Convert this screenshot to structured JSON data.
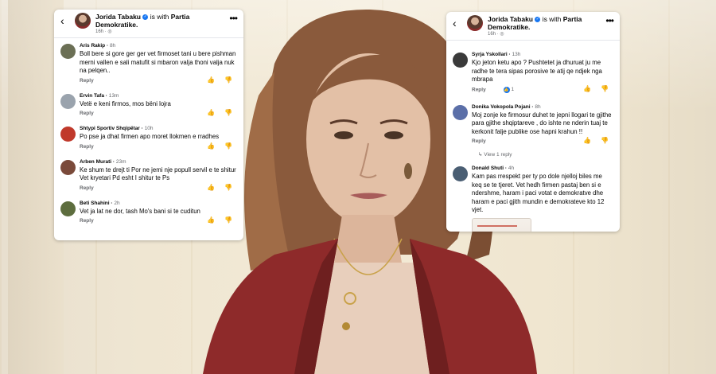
{
  "left_panel": {
    "header": {
      "author": "Jorida Tabaku",
      "with_text": "is with",
      "group": "Partia Demokratike.",
      "time": "16h · "
    },
    "comments": [
      {
        "name": "Aris Rakip",
        "time": "8h",
        "text": "Boll bere si gore ger ger vet firmoset tani u bere pishman merni vallen e sali matufit si mbaron valja thoni valja nuk na pelqen..",
        "reply": "Reply",
        "avatar_color": "#6b6f55"
      },
      {
        "name": "Ervin Tafa",
        "time": "13m",
        "text": "Vetë e keni firmos, mos bëni lojra",
        "reply": "Reply",
        "avatar_color": "#9aa3ad"
      },
      {
        "name": "Shtypi Sportiv Shqipëtar",
        "time": "10h",
        "text": "Po pse ja dhat firmen apo moret llokmen e rradhes",
        "reply": "Reply",
        "avatar_color": "#c0392b"
      },
      {
        "name": "Arben Murati",
        "time": "23m",
        "text": "Ke shum te drejt ti      Por ne jemi  nje popull servil e te shitur Vet kryetari Pd esht I shitur te Ps",
        "reply": "Reply",
        "avatar_color": "#7a4a3a"
      },
      {
        "name": "Beti Shahini",
        "time": "2h",
        "text": "Vet ja lat ne dor, tash Mo's bani si te cuditun",
        "reply": "Reply",
        "avatar_color": "#5d6d3e"
      }
    ]
  },
  "right_panel": {
    "header": {
      "author": "Jorida Tabaku",
      "with_text": "is with",
      "group": "Partia Demokratike.",
      "time": "16h · "
    },
    "comments": [
      {
        "name": "Syrja Yskollari",
        "time": "13h",
        "text": "Kjo jeton ketu apo ? Pushtetet ja dhuruat ju me radhe te tera sipas porosive te atij qe ndjek nga mbrapa",
        "reply": "Reply",
        "likes": "1",
        "avatar_color": "#3a3a3a"
      },
      {
        "name": "Donika Vokopola Pojani",
        "time": "8h",
        "text": "Moj zonje ke firmosur duhet te jepni llogari te gjithe para gjithe  shqiptareve , do ishte ne nderin tuaj te kerkonit falje publike ose hapni krahun !!",
        "reply": "Reply",
        "view_reply": "View 1 reply",
        "avatar_color": "#5b6fa8"
      },
      {
        "name": "Donald Shuti",
        "time": "4h",
        "text": "Kam pas rrespekt per ty po dole njelloj biles me keq se te tjeret. Vet hedh firmen pastaj ben si e ndershme, haram i paci votat e demokratve dhe haram e paci gjith mundin e demokrateve kto 12 vjet.",
        "avatar_color": "#4a5e73"
      }
    ]
  }
}
